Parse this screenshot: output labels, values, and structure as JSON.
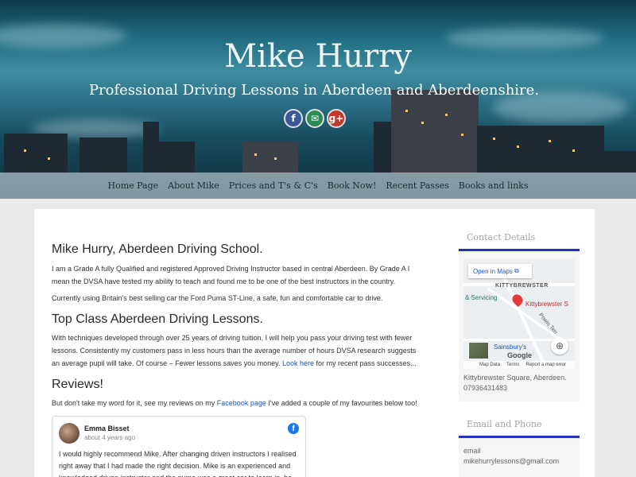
{
  "site": {
    "title": "Mike Hurry",
    "tagline": "Professional Driving Lessons in Aberdeen and Aberdeenshire."
  },
  "social": [
    {
      "icon": "facebook-icon",
      "glyph": "f"
    },
    {
      "icon": "email-icon",
      "glyph": "✉"
    },
    {
      "icon": "google-plus-icon",
      "glyph": "g+"
    }
  ],
  "nav": [
    "Home Page",
    "About Mike",
    "Prices and T's & C's",
    "Book Now!",
    "Recent Passes",
    "Books and links"
  ],
  "main": {
    "h1": "Mike Hurry, Aberdeen Driving School.",
    "p1": "I am a Grade A fully Qualified and registered Approved Driving Instructor based in central Aberdeen. By Grade A I mean the DVSA have tested my ability to teach and found me to be one of the best instructors in the country.",
    "p2": "Currently using Britain's best selling car the Ford Puma ST-Line, a safe, fun and comfortable car to drive.",
    "h2": "Top Class Aberdeen Driving Lessons.",
    "p3": "With techniques developed through over 25 years of driving tuition, I will help you pass your driving test with fewer lessons. Consistently my customers pass in less hours than the average number of hours DVSA research suggests an average pupil will take. Of course – Fewer lessons saves you money.",
    "p3_link": "Look here",
    "p3_tail": " for my recent pass successes...",
    "h3": "Reviews!",
    "p4_pre": "But don't take my word for it, see my reviews on my ",
    "p4_link": "Facebook page",
    "p4_tail": " I've added a couple of my favourites below too!"
  },
  "review": {
    "name": "Emma Bisset",
    "time": "about 4 years ago",
    "text": "I would highly recommend Mike. After changing driven instructors I realised right away that I had made the right decision. Mike is an experienced and knowledged driven instructor and the puma was a great car to learn in. he"
  },
  "sidebar": {
    "contact_title": "Contact Details",
    "map": {
      "open_label": "Open in Maps",
      "area_label": "KITTYBREWSTER",
      "service_label": "& Servicing",
      "place_label": "Kittybrewster S",
      "road_label": "Powis Terr",
      "shop_label": "Sainsbury's",
      "google_label": "Google",
      "footer": [
        "Map Data",
        "Terms",
        "Report a map error"
      ]
    },
    "address": "Kittybrewster Square, Aberdeen.",
    "phone": "07936431483",
    "email_title": "Email and Phone",
    "email_label": "email",
    "email": "mikehurrylessons@gmail.com"
  }
}
